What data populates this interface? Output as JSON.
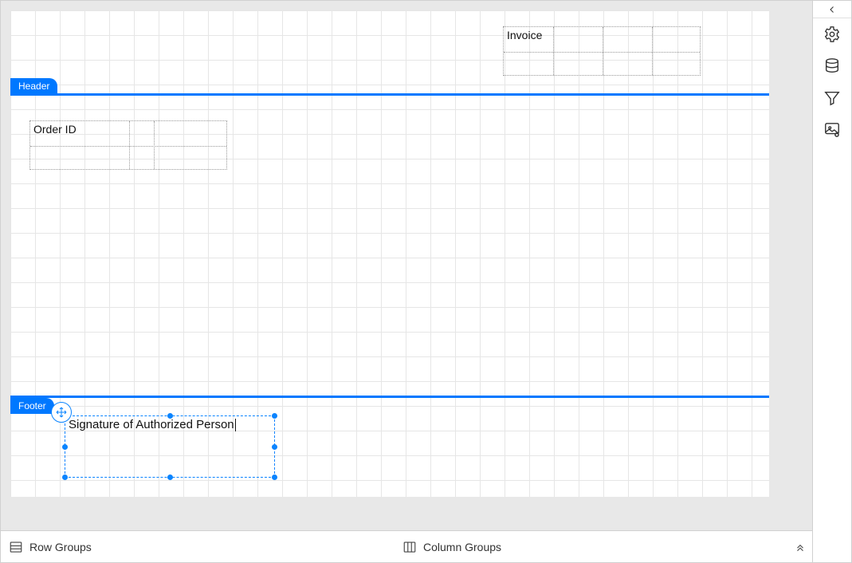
{
  "sections": {
    "header_label": "Header",
    "footer_label": "Footer"
  },
  "items": {
    "invoice": {
      "text": "Invoice"
    },
    "order_id": {
      "text": "Order ID"
    },
    "signature": {
      "text": "Signature of Authorized Person"
    }
  },
  "bottom_bar": {
    "row_groups": "Row Groups",
    "column_groups": "Column Groups"
  },
  "side_panel": {
    "icons": [
      "settings",
      "data",
      "filter",
      "image-settings"
    ]
  }
}
